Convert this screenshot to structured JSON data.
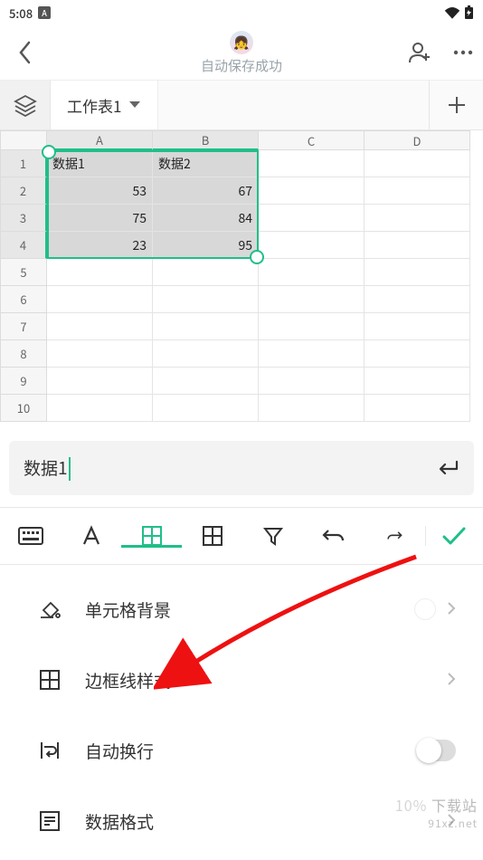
{
  "status": {
    "time": "5:08",
    "badge": "A"
  },
  "header": {
    "save_text": "自动保存成功"
  },
  "tabs": {
    "active": "工作表1"
  },
  "sheet": {
    "columns": [
      "A",
      "B",
      "C",
      "D"
    ],
    "rows": [
      "1",
      "2",
      "3",
      "4",
      "5",
      "6",
      "7",
      "8",
      "9",
      "10"
    ],
    "cells": {
      "A1": "数据1",
      "B1": "数据2",
      "A2": "53",
      "B2": "67",
      "A3": "75",
      "B3": "84",
      "A4": "23",
      "B4": "95"
    }
  },
  "formula": {
    "value": "数据1"
  },
  "options": {
    "bg": "单元格背景",
    "border": "边框线样式",
    "wrap": "自动换行",
    "format": "数据格式"
  },
  "watermark": {
    "main": "下载站",
    "sub": "91xz.net",
    "pct": "10%"
  },
  "chart_data": {
    "type": "table",
    "categories": [
      "数据1",
      "数据2"
    ],
    "series": [
      {
        "name": "数据1",
        "values": [
          53,
          75,
          23
        ]
      },
      {
        "name": "数据2",
        "values": [
          67,
          84,
          95
        ]
      }
    ]
  }
}
